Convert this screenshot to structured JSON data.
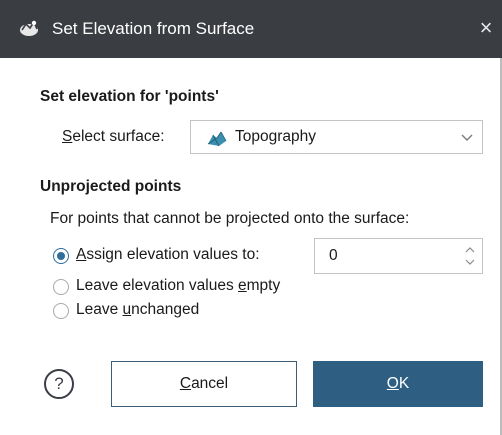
{
  "window": {
    "title": "Set Elevation from Surface",
    "close_glyph": "×",
    "title_icon": "geo-app-icon"
  },
  "surface_section": {
    "heading": "Set elevation for 'points'",
    "select_label_mnemonic": "S",
    "select_label_rest": "elect surface:",
    "selected_surface": "Topography",
    "surface_icon": "surface-mesh-icon",
    "dropdown_icon": "chevron-down-icon"
  },
  "unprojected_section": {
    "heading": "Unprojected points",
    "description": "For points that cannot be projected onto the surface:",
    "options": [
      {
        "pre": "",
        "mnemonic": "A",
        "post": "ssign elevation values to:",
        "checked": true
      },
      {
        "pre": "Leave elevation values ",
        "mnemonic": "e",
        "post": "mpty",
        "checked": false
      },
      {
        "pre": "Leave ",
        "mnemonic": "u",
        "post": "nchanged",
        "checked": false
      }
    ],
    "elevation_value": "0"
  },
  "footer": {
    "help_glyph": "?",
    "cancel_mnemonic": "C",
    "cancel_rest": "ancel",
    "ok_mnemonic": "O",
    "ok_rest": "K"
  },
  "colors": {
    "titlebar": "#3a3d42",
    "accent": "#2e5f83",
    "radio_checked": "#2f6e9a"
  }
}
